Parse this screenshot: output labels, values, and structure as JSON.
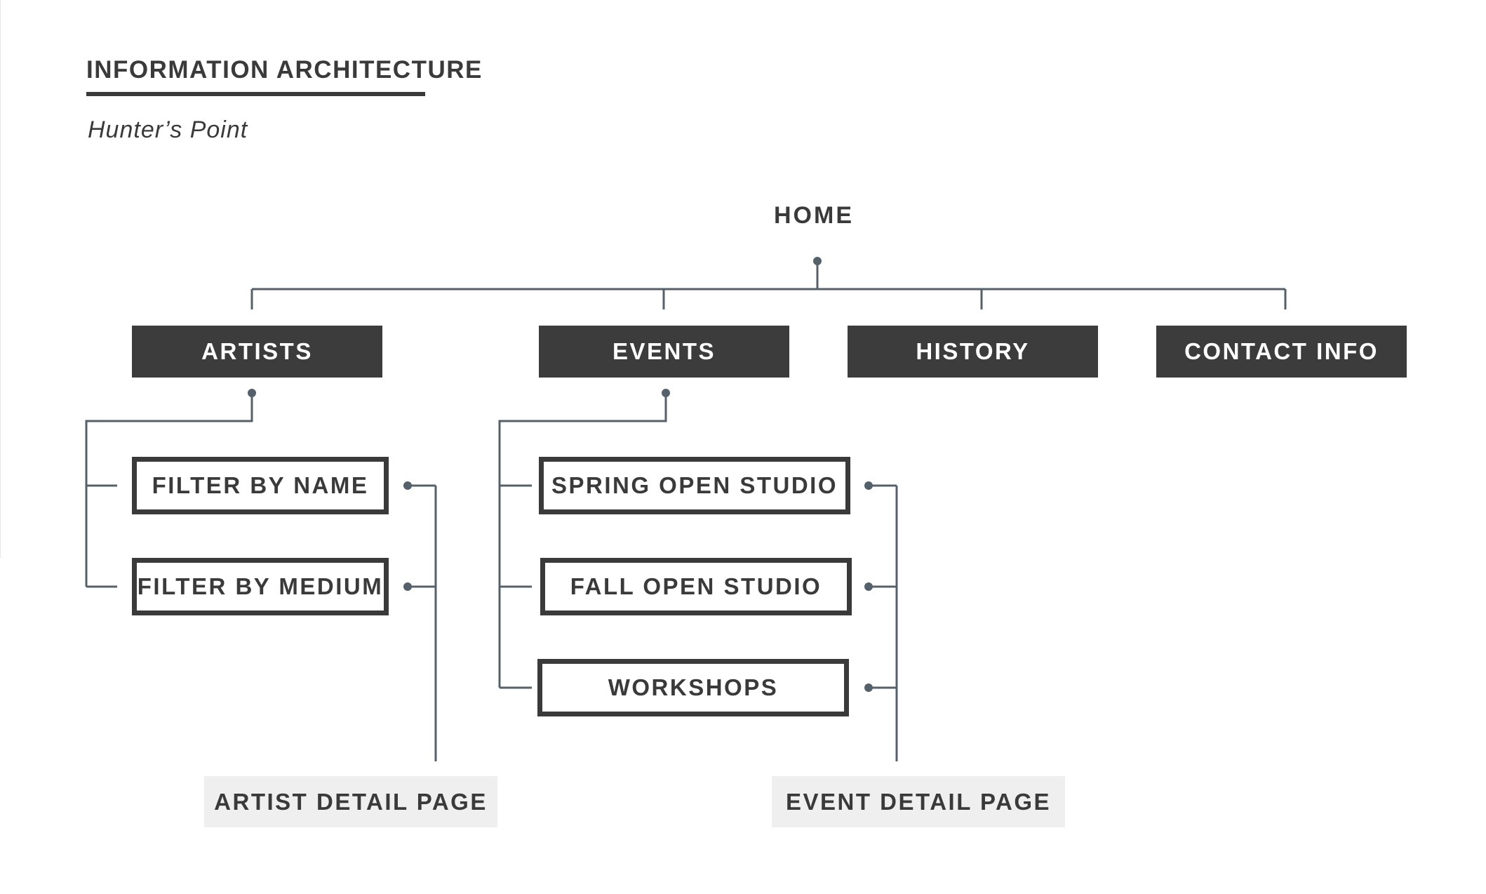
{
  "header": {
    "title": "INFORMATION ARCHITECTURE",
    "subtitle": "Hunter’s Point"
  },
  "sitemap": {
    "root": "HOME",
    "sections": [
      "ARTISTS",
      "EVENTS",
      "HISTORY",
      "CONTACT INFO"
    ],
    "artists_children": [
      "FILTER BY NAME",
      "FILTER BY MEDIUM"
    ],
    "events_children": [
      "SPRING OPEN STUDIO",
      "FALL OPEN STUDIO",
      "WORKSHOPS"
    ],
    "detail_pages": [
      "ARTIST DETAIL PAGE",
      "EVENT DETAIL PAGE"
    ]
  },
  "colors": {
    "primary_fill": "#3c3c3c",
    "text": "#3a3a3a",
    "connector": "#55616a",
    "detail_fill": "#efefef"
  }
}
